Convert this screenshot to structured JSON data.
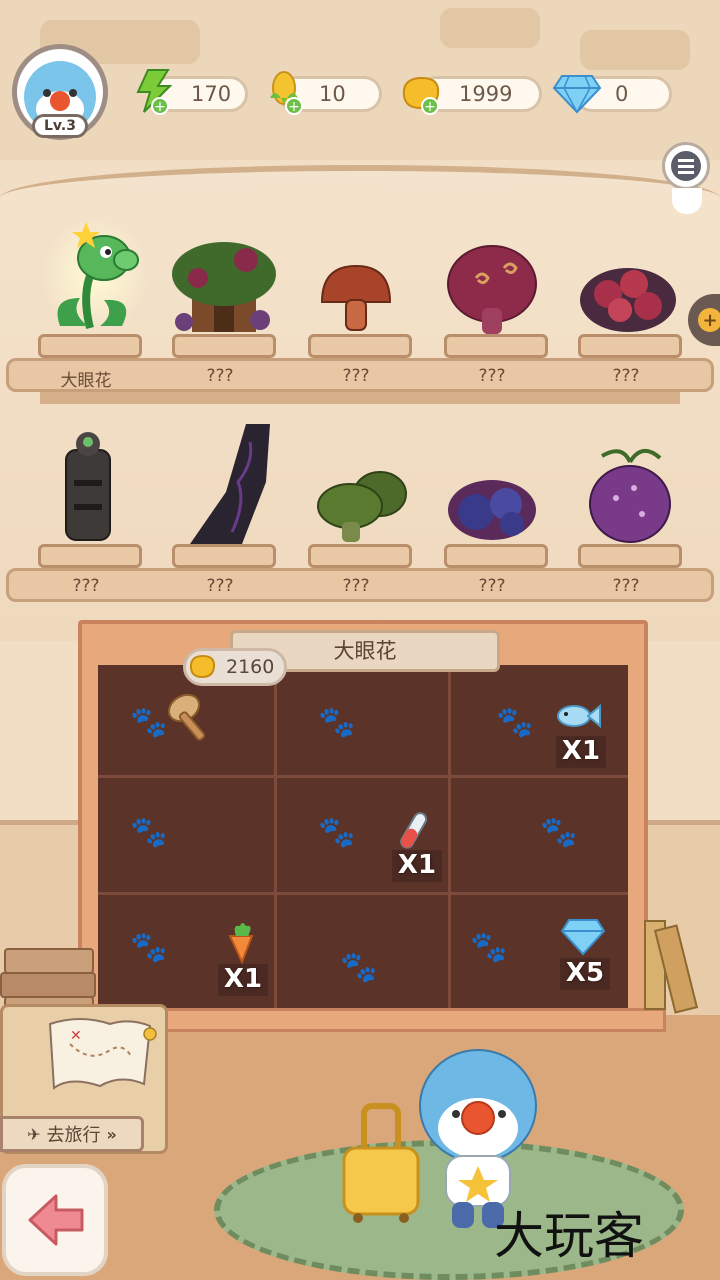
{
  "player": {
    "level": "Lv.3"
  },
  "resources": [
    {
      "name": "energy",
      "icon": "lightning-icon",
      "value": "170"
    },
    {
      "name": "corn",
      "icon": "corn-icon",
      "value": "10"
    },
    {
      "name": "coin",
      "icon": "gold-nugget-icon",
      "value": "1999"
    },
    {
      "name": "diamond",
      "icon": "diamond-icon",
      "value": "0"
    }
  ],
  "shelf_top": [
    {
      "label": "大眼花",
      "icon": "eye-flower-plant-icon"
    },
    {
      "label": "???",
      "icon": "bush-house-icon"
    },
    {
      "label": "???",
      "icon": "red-mushroom-icon"
    },
    {
      "label": "???",
      "icon": "purple-spiral-mushroom-icon"
    },
    {
      "label": "???",
      "icon": "red-berry-bush-icon"
    }
  ],
  "shelf_bottom": [
    {
      "label": "???",
      "icon": "stone-totem-icon"
    },
    {
      "label": "???",
      "icon": "dark-spire-icon"
    },
    {
      "label": "???",
      "icon": "green-mushroom-icon"
    },
    {
      "label": "???",
      "icon": "blueberry-cluster-icon"
    },
    {
      "label": "???",
      "icon": "purple-pumpkin-icon"
    }
  ],
  "board": {
    "title": "大眼花",
    "cost": "2160",
    "rewards": [
      {
        "icon": "fish-icon",
        "count": "X1"
      },
      {
        "icon": "test-tube-icon",
        "count": "X1"
      },
      {
        "icon": "carrot-icon",
        "count": "X1"
      },
      {
        "icon": "diamond-icon",
        "count": "X5"
      }
    ]
  },
  "travel_button": {
    "label": "去旅行",
    "icon": "airplane-icon"
  },
  "watermark": "大玩客",
  "colors": {
    "board": "#5b3328",
    "frame": "#e7a97c",
    "shelf": "#e8c8a4",
    "accent": "#f2b43c"
  }
}
